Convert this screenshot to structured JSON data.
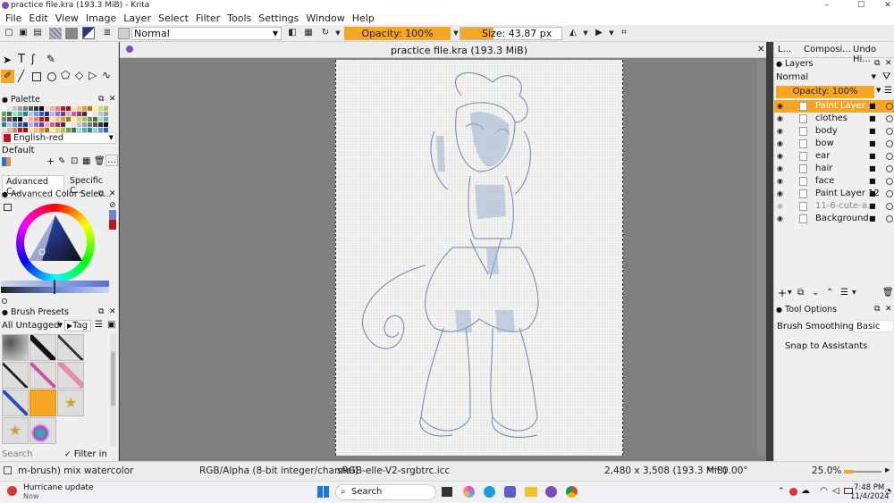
{
  "window": {
    "title": "practice file.kra (193.3 MiB) - Krita",
    "minimize": "–",
    "maximize": "☐",
    "close": "✕"
  },
  "menu": [
    "File",
    "Edit",
    "View",
    "Image",
    "Layer",
    "Select",
    "Filter",
    "Tools",
    "Settings",
    "Window",
    "Help"
  ],
  "toolbar": {
    "blend_mode": "Normal",
    "opacity": "Opacity: 100%",
    "size": "Size: 43.87 px"
  },
  "left_dock": {
    "palette": {
      "title": "Palette",
      "color_name": "English-red",
      "set_name": "Default"
    },
    "color_tabs": [
      "Advanced C...",
      "Specific C..."
    ],
    "color_selector_title": "Advanced Color Selec...",
    "brush_presets": {
      "title": "Brush Presets",
      "tag_filter": "All Untagged",
      "tag_button": "Tag",
      "search_placeholder": "Search",
      "filter_in_tag": "Filter in Tag"
    }
  },
  "document_tab": {
    "title": "practice file.kra (193.3 MiB)",
    "close": "✕"
  },
  "right_dock": {
    "tabs": [
      "L...",
      "Composi...",
      "Undo Hi..."
    ],
    "layers_title": "Layers",
    "blend_mode": "Normal",
    "opacity": "Opacity: 100%",
    "layers": [
      {
        "name": "Paint Layer...",
        "selected": true,
        "visible": true
      },
      {
        "name": "clothes",
        "selected": false,
        "visible": true
      },
      {
        "name": "body",
        "selected": false,
        "visible": true
      },
      {
        "name": "bow",
        "selected": false,
        "visible": true
      },
      {
        "name": "ear",
        "selected": false,
        "visible": true
      },
      {
        "name": "hair",
        "selected": false,
        "visible": true
      },
      {
        "name": "face",
        "selected": false,
        "visible": true
      },
      {
        "name": "Paint Layer 12",
        "selected": false,
        "visible": true
      },
      {
        "name": "11-6-cute-a...",
        "selected": false,
        "visible": false
      },
      {
        "name": "Background",
        "selected": false,
        "visible": true
      }
    ],
    "tool_options": {
      "title": "Tool Options",
      "smoothing_label": "Brush Smoothing:",
      "smoothing_value": "Basic",
      "snap_label": "Snap to Assistants"
    }
  },
  "status": {
    "brush": "m-brush) mix watercolor",
    "color_space": "RGB/Alpha (8-bit integer/channel)",
    "profile": "sRGB-elle-V2-srgbtrc.icc",
    "image_size": "2,480 x 3,508 (193.3 MiB)",
    "rotation": "0.00°",
    "zoom": "25.0%"
  },
  "taskbar": {
    "notif_title": "Hurricane update",
    "notif_sub": "Now",
    "search": "Search",
    "time": "7:48 PM",
    "date": "11/4/2024"
  },
  "colors": {
    "accent": "#f6a623",
    "selected_layer": "#f6a623"
  }
}
